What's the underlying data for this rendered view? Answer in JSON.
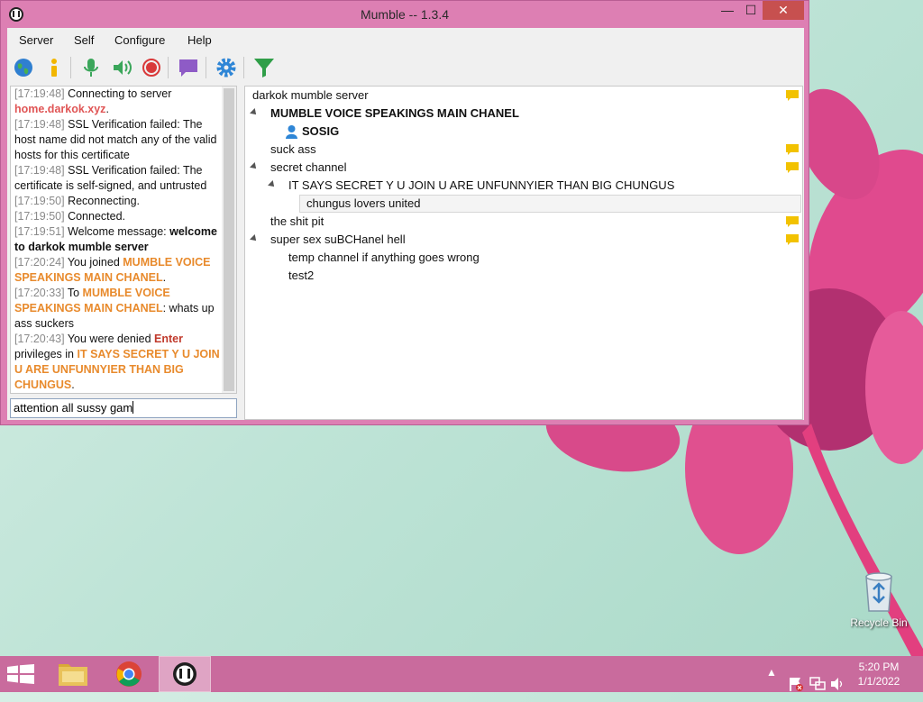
{
  "window": {
    "title": "Mumble -- 1.3.4",
    "controls": {
      "minimize": "—",
      "maximize": "☐",
      "close": "✕"
    }
  },
  "menu": [
    "Server",
    "Self",
    "Configure",
    "Help"
  ],
  "toolbar": {
    "icons": [
      "globe-icon",
      "info-icon",
      "microphone-icon",
      "speaker-icon",
      "record-icon",
      "comment-icon",
      "settings-gear-icon",
      "filter-icon"
    ]
  },
  "chat": {
    "messages": [
      {
        "ts": "[17:19:48]",
        "parts": [
          {
            "t": " Connecting to server "
          },
          {
            "t": "home.darkok.xyz",
            "c": "link-red"
          },
          {
            "t": "."
          }
        ]
      },
      {
        "ts": "[17:19:48]",
        "parts": [
          {
            "t": " SSL Verification failed: The host name did not match any of the valid hosts for this certificate"
          }
        ]
      },
      {
        "ts": "[17:19:48]",
        "parts": [
          {
            "t": " SSL Verification failed: The certificate is self-signed, and untrusted"
          }
        ]
      },
      {
        "ts": "[17:19:50]",
        "parts": [
          {
            "t": " Reconnecting."
          }
        ]
      },
      {
        "ts": "[17:19:50]",
        "parts": [
          {
            "t": " Connected."
          }
        ]
      },
      {
        "ts": "[17:19:51]",
        "parts": [
          {
            "t": " Welcome message: "
          },
          {
            "t": "welcome to darkok mumble server",
            "c": "bold"
          }
        ]
      },
      {
        "ts": "[17:20:24]",
        "parts": [
          {
            "t": " You joined "
          },
          {
            "t": "MUMBLE VOICE SPEAKINGS MAIN CHANEL",
            "c": "chan"
          },
          {
            "t": "."
          }
        ]
      },
      {
        "ts": "[17:20:33]",
        "parts": [
          {
            "t": " To "
          },
          {
            "t": "MUMBLE VOICE SPEAKINGS MAIN CHANEL",
            "c": "chan"
          },
          {
            "t": ": whats up ass suckers"
          }
        ]
      },
      {
        "ts": "[17:20:43]",
        "parts": [
          {
            "t": " You were denied "
          },
          {
            "t": "Enter",
            "c": "denied"
          },
          {
            "t": " privileges in "
          },
          {
            "t": "IT SAYS SECRET Y U JOIN U ARE UNFUNNYIER THAN BIG CHUNGUS",
            "c": "chan"
          },
          {
            "t": "."
          }
        ]
      }
    ],
    "input_value": "attention all sussy gam"
  },
  "tree": {
    "server": "darkok mumble server",
    "channels": [
      {
        "label": "MUMBLE VOICE SPEAKINGS MAIN CHANEL",
        "bold": true
      },
      {
        "label": "SOSIG",
        "user": true
      },
      {
        "label": "suck ass"
      },
      {
        "label": "secret channel"
      },
      {
        "label": "IT SAYS SECRET Y U JOIN U ARE UNFUNNYIER THAN BIG CHUNGUS"
      },
      {
        "label": "chungus lovers united",
        "selected": true
      },
      {
        "label": "the shit pit"
      },
      {
        "label": "super sex suBCHanel hell"
      },
      {
        "label": "temp channel if anything goes wrong"
      },
      {
        "label": "test2"
      }
    ]
  },
  "desktop": {
    "recycle_bin": "Recycle Bin"
  },
  "taskbar": {
    "apps": [
      "windows-start-icon",
      "file-explorer-icon",
      "chrome-icon",
      "mumble-icon"
    ],
    "clock_time": "5:20 PM",
    "clock_date": "1/1/2022"
  }
}
